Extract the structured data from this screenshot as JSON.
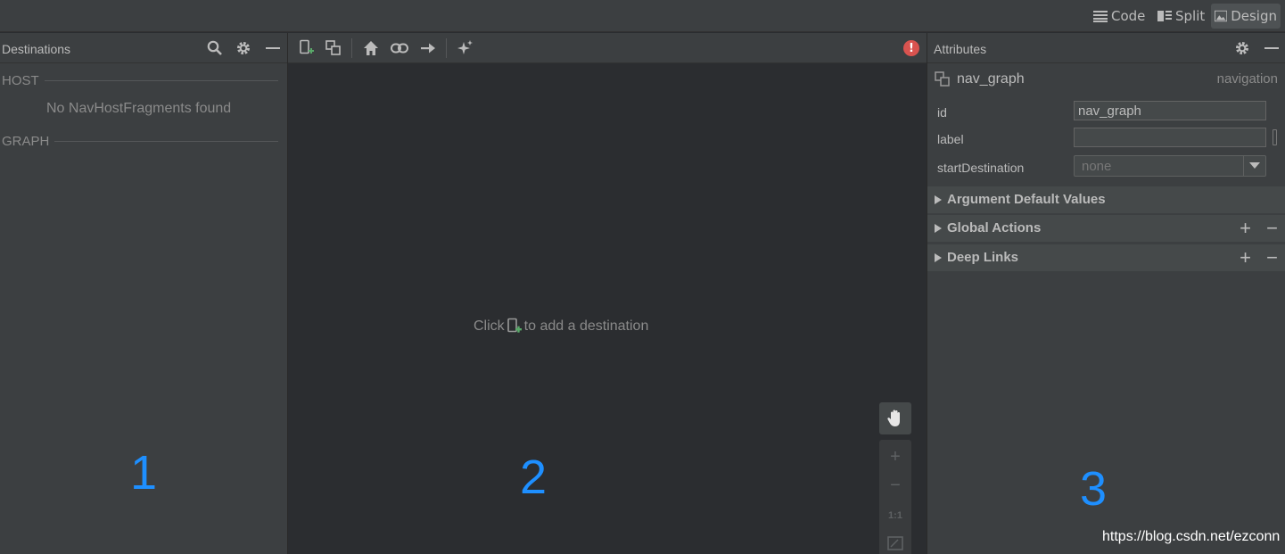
{
  "view_modes": [
    {
      "label": "Code",
      "icon": "lines-icon"
    },
    {
      "label": "Split",
      "icon": "split-view-icon"
    },
    {
      "label": "Design",
      "icon": "image-icon",
      "active": true
    }
  ],
  "destinations_panel": {
    "title": "Destinations",
    "icons": [
      "search-icon",
      "gear-icon",
      "minimize-icon"
    ],
    "host_section": "HOST",
    "host_empty": "No NavHostFragments found",
    "graph_section": "GRAPH",
    "marker": "1"
  },
  "editor": {
    "toolbar_icons": [
      "new-destination-icon",
      "nested-graph-icon",
      "home-icon",
      "link-icon",
      "arrow-right-icon",
      "auto-arrange-icon"
    ],
    "error_icon": "error-icon",
    "hint_before": "Click",
    "hint_after": "to add a destination",
    "zoom": {
      "actual_size": "1:1"
    },
    "marker": "2"
  },
  "attributes_panel": {
    "title": "Attributes",
    "element_name": "nav_graph",
    "element_type": "navigation",
    "fields": {
      "id_label": "id",
      "id_value": "nav_graph",
      "label_label": "label",
      "label_value": "",
      "start_label": "startDestination",
      "start_value": "none"
    },
    "sections": [
      {
        "title": "Argument Default Values",
        "has_add": false
      },
      {
        "title": "Global Actions",
        "has_add": true
      },
      {
        "title": "Deep Links",
        "has_add": true
      }
    ],
    "marker": "3"
  },
  "watermark": "https://blog.csdn.net/ezconn",
  "colors": {
    "accent_number": "#1e8fff",
    "error": "#d9534f",
    "add_green": "#59a869"
  }
}
